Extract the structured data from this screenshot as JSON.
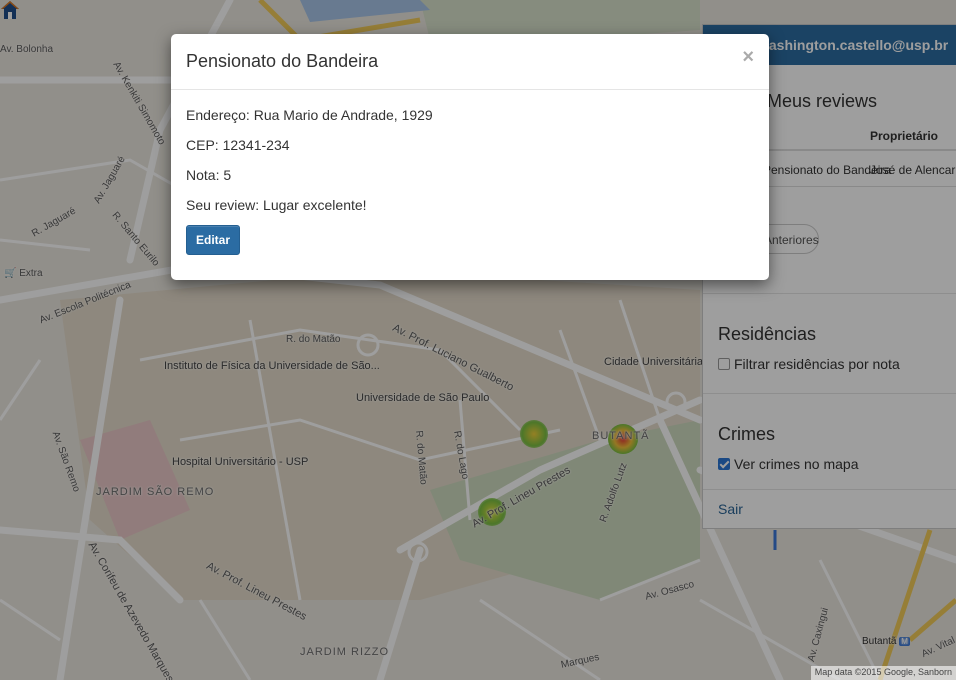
{
  "map": {
    "labels": {
      "av_bolonha": "Av. Bolonha",
      "av_kenkiti": "Av. Kenkiti Simomoto",
      "av_jaguare": "Av. Jaguaré",
      "r_jaguare": "R. Jaguaré",
      "r_santo_eurilo": "R. Santo Eurilo",
      "av_escola_politecnica": "Av. Escola Politécnica",
      "extra": "Extra",
      "r_do_matao": "R. do Matão",
      "av_luciano_gualberto": "Av. Prof. Luciano Gualberto",
      "instituto_fisica": "Instituto de Física da Universidade de São...",
      "universidade_sp": "Universidade de São Paulo",
      "cidade_universitaria": "Cidade Universitária",
      "hospital": "Hospital Universitário - USP",
      "jardim_sao_remo": "JARDIM SÃO REMO",
      "av_lineu_prestes": "Av. Prof. Lineu Prestes",
      "av_lineu_prestes_2": "Av. Prof. Lineu Prestes",
      "av_corifeu": "Av. Corifeu de Azevedo Marques",
      "butanta_district": "BUTANTÃ",
      "jardim_rizzo": "JARDIM RIZZO",
      "av_sao_remo": "Av. São Remo",
      "r_do_lago": "R. do Lago",
      "r_do_matao_2": "R. do Matão",
      "av_osasco": "Av. Osasco",
      "r_adolfo_lutz": "R. Adolfo Lutz",
      "av_caxingui": "Av. Caxingui",
      "butanta_station": "Butantã",
      "av_vital": "Av. Vital",
      "marques": "Marques"
    },
    "attribution": "Map data ©2015 Google, Sanborn"
  },
  "side_panel": {
    "user_email": "washington.castello@usp.br",
    "reviews_title": "Meus reviews",
    "table_owner_header": "Proprietário",
    "row_name": "Pensionato do Bandeira",
    "row_owner": "José de Alencar",
    "previous_button": "Anteriores",
    "residences_title": "Residências",
    "filter_label": "Filtrar residências por nota",
    "crimes_title": "Crimes",
    "crimes_label": "Ver crimes no mapa",
    "logout": "Sair"
  },
  "modal": {
    "title": "Pensionato do Bandeira",
    "close_symbol": "×",
    "address": "Endereço: Rua Mario de Andrade, 1929",
    "cep": "CEP: 12341-234",
    "rating": "Nota: 5",
    "review": "Seu review: Lugar excelente!",
    "edit_button": "Editar"
  },
  "colors": {
    "primary": "#2b6ca3",
    "header_blue": "#2d6ca2",
    "heatmap_red": "#e53935",
    "heatmap_green": "#7cc043"
  },
  "icons": {
    "house": "house-icon",
    "close": "close-icon"
  }
}
